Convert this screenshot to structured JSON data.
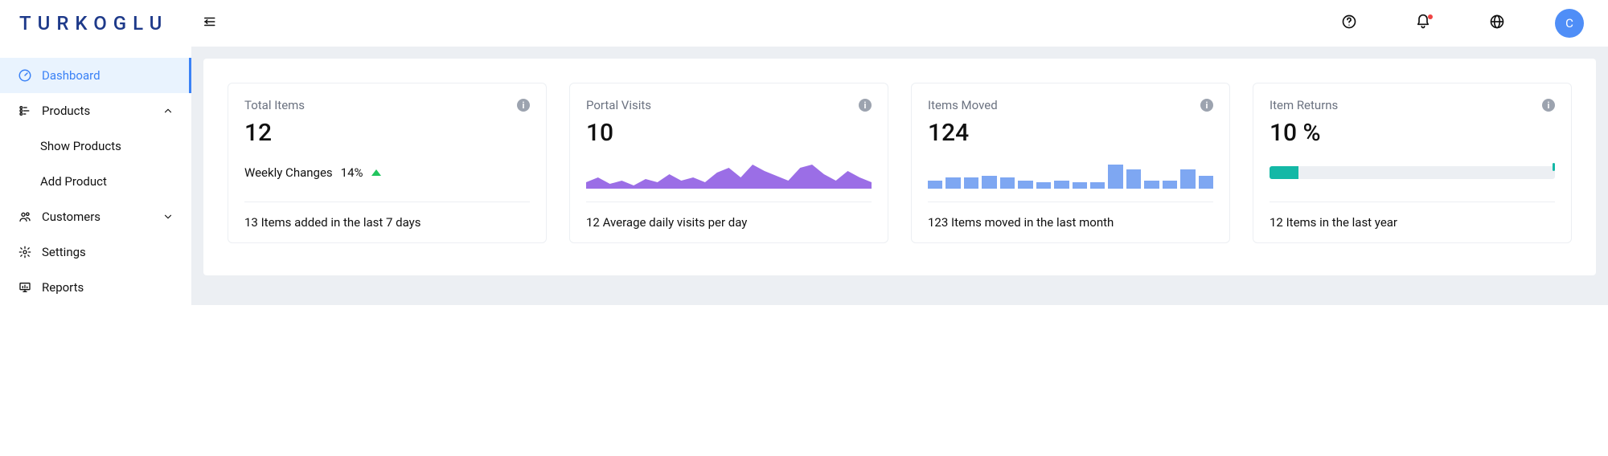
{
  "header": {
    "logo_text": "TURKOGLU",
    "avatar_initial": "C"
  },
  "sidebar": {
    "items": [
      {
        "label": "Dashboard"
      },
      {
        "label": "Products"
      },
      {
        "label": "Customers"
      },
      {
        "label": "Settings"
      },
      {
        "label": "Reports"
      }
    ],
    "products_sub": [
      {
        "label": "Show Products"
      },
      {
        "label": "Add Product"
      }
    ]
  },
  "cards": {
    "total_items": {
      "title": "Total Items",
      "value": "12",
      "weekly_label": "Weekly Changes",
      "weekly_pct": "14%",
      "footer": "13 Items added in the last 7 days"
    },
    "portal_visits": {
      "title": "Portal Visits",
      "value": "10",
      "footer": "12 Average daily visits per day"
    },
    "items_moved": {
      "title": "Items Moved",
      "value": "124",
      "footer": "123 Items moved in the last month"
    },
    "item_returns": {
      "title": "Item Returns",
      "value": "10 %",
      "progress_pct": 10,
      "footer": "12 Items in the last year"
    }
  },
  "chart_data": [
    {
      "type": "area",
      "title": "Portal Visits sparkline",
      "x": [
        0,
        1,
        2,
        3,
        4,
        5,
        6,
        7,
        8,
        9,
        10,
        11,
        12,
        13,
        14,
        15,
        16,
        17,
        18,
        19,
        20,
        21,
        22,
        23,
        24
      ],
      "values": [
        8,
        14,
        6,
        10,
        4,
        12,
        8,
        18,
        10,
        14,
        8,
        20,
        26,
        14,
        30,
        22,
        16,
        10,
        26,
        30,
        18,
        10,
        22,
        14,
        8
      ],
      "ylim": [
        0,
        36
      ],
      "color": "#9b6ee6"
    },
    {
      "type": "bar",
      "title": "Items Moved sparkline",
      "categories": [
        "",
        "",
        "",
        "",
        "",
        "",
        "",
        "",
        "",
        "",
        "",
        "",
        "",
        "",
        "",
        ""
      ],
      "values": [
        10,
        14,
        14,
        16,
        14,
        10,
        8,
        10,
        8,
        8,
        30,
        24,
        10,
        10,
        24,
        16
      ],
      "ylim": [
        0,
        36
      ],
      "color": "#7ea7f2"
    },
    {
      "type": "bar",
      "title": "Item Returns progress",
      "categories": [
        "returns"
      ],
      "values": [
        10
      ],
      "ylim": [
        0,
        100
      ],
      "color": "#14b8a6"
    }
  ]
}
